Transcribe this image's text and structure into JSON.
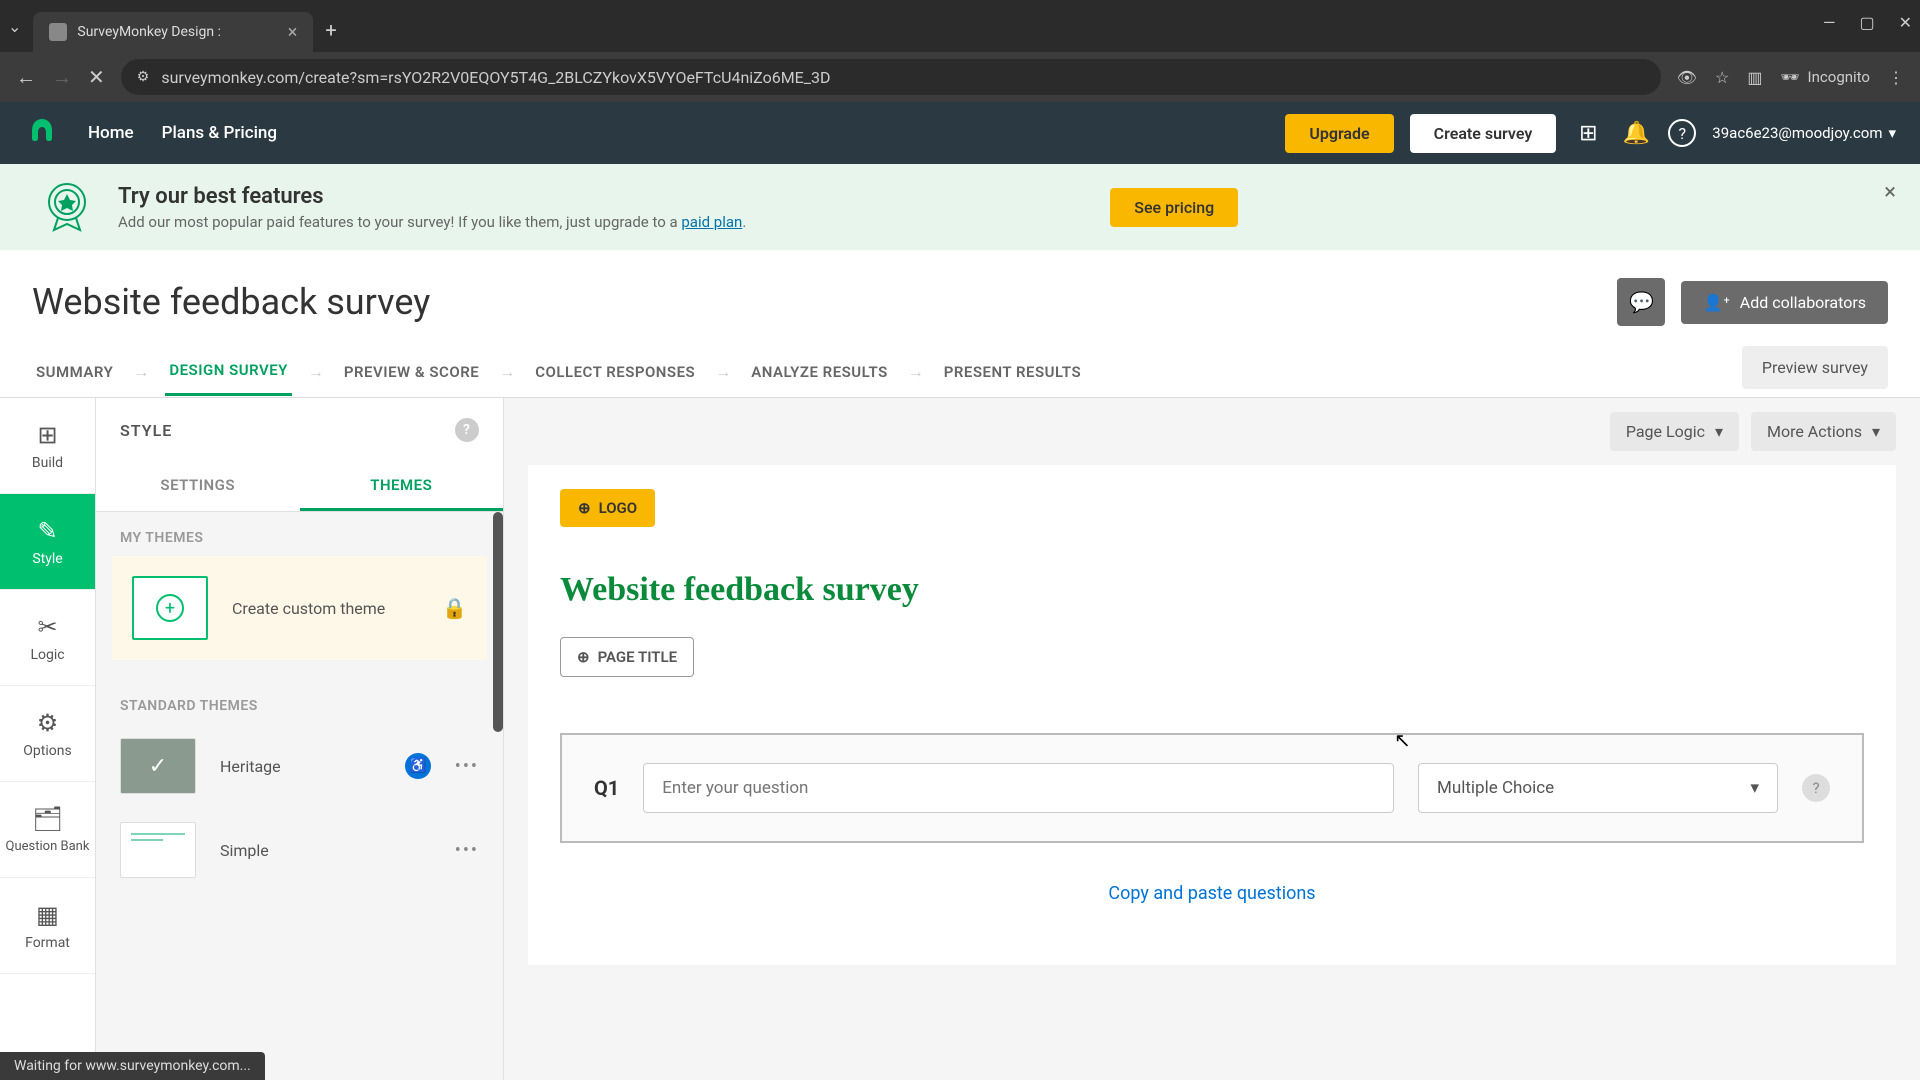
{
  "browser": {
    "tab_title": "SurveyMonkey Design :",
    "url": "surveymonkey.com/create?sm=rsYO2R2V0EQOY5T4G_2BLCZYkovX5VYOeFTcU4niZo6ME_3D",
    "incognito": "Incognito",
    "status": "Waiting for www.surveymonkey.com..."
  },
  "header": {
    "home": "Home",
    "plans": "Plans & Pricing",
    "upgrade": "Upgrade",
    "create": "Create survey",
    "user_email": "39ac6e23@moodjoy.com"
  },
  "banner": {
    "title": "Try our best features",
    "text": "Add our most popular paid features to your survey! If you like them, just upgrade to a ",
    "link": "paid plan",
    "cta": "See pricing"
  },
  "survey": {
    "title": "Website feedback survey",
    "add_collab": "Add collaborators"
  },
  "nav_tabs": {
    "summary": "SUMMARY",
    "design": "DESIGN SURVEY",
    "preview": "PREVIEW & SCORE",
    "collect": "COLLECT RESPONSES",
    "analyze": "ANALYZE RESULTS",
    "present": "PRESENT RESULTS",
    "preview_btn": "Preview survey"
  },
  "rail": {
    "build": "Build",
    "style": "Style",
    "logic": "Logic",
    "options": "Options",
    "question_bank": "Question Bank",
    "format": "Format"
  },
  "style_panel": {
    "header": "STYLE",
    "settings": "SETTINGS",
    "themes": "THEMES",
    "my_themes": "MY THEMES",
    "create_custom": "Create custom theme",
    "standard_themes": "STANDARD THEMES",
    "heritage": "Heritage",
    "simple": "Simple"
  },
  "canvas": {
    "page_logic": "Page Logic",
    "more_actions": "More Actions",
    "logo_btn": "LOGO",
    "survey_heading": "Website feedback survey",
    "page_title_btn": "PAGE TITLE",
    "q1": "Q1",
    "q_placeholder": "Enter your question",
    "q_type": "Multiple Choice",
    "copy_paste": "Copy and paste questions"
  }
}
